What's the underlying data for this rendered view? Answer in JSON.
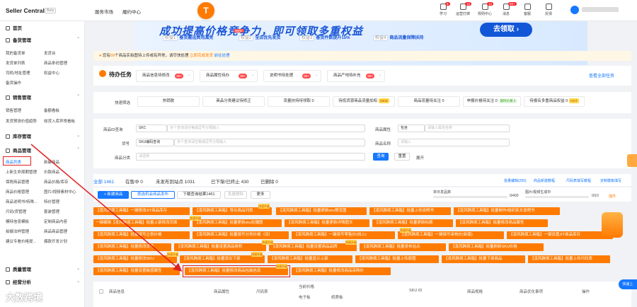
{
  "topbar": {
    "app_title": "Seller Central",
    "beta": "Beta",
    "nav": [
      "服务市场",
      "履约中心"
    ],
    "center_icon": "T",
    "icons": [
      {
        "label": "学习",
        "badge": "8"
      },
      {
        "label": "运营打牌",
        "badge": "10"
      },
      {
        "label": "规则中心",
        "badge": "12"
      },
      {
        "label": "消息",
        "badge": "99+"
      },
      {
        "label": "客服",
        "badge": ""
      },
      {
        "label": "反馈",
        "badge": ""
      }
    ]
  },
  "sidebar": {
    "home": "首页",
    "sections": [
      {
        "title": "备货管理",
        "items": [
          [
            "我的备货单",
            "发货台"
          ],
          [
            "发货单列表",
            "商品条码管理"
          ],
          [
            "司机/地址管理",
            "权益中心"
          ],
          [
            "备货操作",
            ""
          ]
        ]
      },
      {
        "title": "销售管理",
        "items": [
          [
            "销售管理",
            "备额看板"
          ],
          [
            "发货预测价值趋势",
            "收货入库异常看板"
          ]
        ]
      },
      {
        "title": "库存管理",
        "items": []
      },
      {
        "title": "商品管理",
        "items": [
          [
            "商品列表",
            "新建商品"
          ],
          [
            "上新生命周期管理",
            "价款商品"
          ],
          [
            "保税商品管理",
            "商品价格/库存"
          ],
          [
            "商品价格管理",
            "图片/视频素材中心"
          ],
          [
            "商品说明书/特殊...",
            "特价管理"
          ],
          [
            "尺码/货管理",
            "套装管理"
          ],
          [
            "模特信息模板",
            "定制商品内容"
          ],
          [
            "拍摄法样管理",
            "商品商品管理"
          ],
          [
            "建议专看价格提...",
            "爆款开发计划"
          ]
        ]
      },
      {
        "title": "质量管理",
        "items": []
      },
      {
        "title": "经营分析",
        "items": []
      }
    ]
  },
  "banner": {
    "title": "成功提高价格竞争力，即可领取多重权益",
    "items": [
      [
        "权益1",
        "备货搬运费用减免"
      ],
      [
        "权益2",
        "全店优先发货"
      ],
      [
        "权益3",
        "备货件数提升15%"
      ],
      [
        "权益4",
        "商品流量保障扶持"
      ]
    ],
    "new": "NEW",
    "button": "去领取 ›"
  },
  "notice": {
    "pre": "您有",
    "count": "89",
    "mid": "个商品实拍图待上传或有异常，请尽快处理",
    "l1": "立即完成发货",
    "l2": "前往处理"
  },
  "todo": {
    "title": "待办任务",
    "items": [
      {
        "label": "商品信息待修改",
        "count": "99+"
      },
      {
        "label": "商品属性待办",
        "count": "99+"
      },
      {
        "label": "说明书待处理",
        "count": "99+"
      },
      {
        "label": "商品产地待补充",
        "count": "99+"
      }
    ],
    "view_all": "查看全部任务"
  },
  "quick": {
    "label": "快速筛选",
    "row1": [
      "热销款",
      "商品分类建议待修正",
      "流量扶持待领取  0",
      "待低货源商品流量加权",
      "商品流量待关注  0",
      "申报价格待关注  0",
      "待报名多重商品权益  0"
    ],
    "new": "NEW",
    "tag1": "限时价格 0",
    "hot": "HOT"
  },
  "form": {
    "id_label": "商品ID查询",
    "id_type": "SKC",
    "id_ph": "多个查询请空格或逗号分隔输入",
    "attr_label": "商品属性",
    "attr_sel": "包含",
    "attr_ph": "请输入属性名称",
    "code_label": "货号",
    "code_type": "SKU编码查询",
    "code_ph": "多个查询请空格或逗号分隔输入",
    "name_label": "商品名称",
    "name_ph": "请输入",
    "cat_label": "商品分类",
    "cat_ph": "请选择",
    "search": "查询",
    "reset": "重置",
    "expand": "展开"
  },
  "tabs": {
    "items": [
      "全部 1461",
      "在售中 0",
      "未发布到站点 1031",
      "已下架/已终止 430",
      "已删除 0"
    ],
    "right": [
      "批量编辑(265)",
      "商品新建教程",
      "尺码表填写教程",
      "定制模板填写"
    ]
  },
  "actions": {
    "new": "+ 新建商品",
    "copy": "挑选机会商品发布",
    "download": "下载查询结果1461",
    "batch_del": "批量删除",
    "more": "更多",
    "progress_label": "单日发品数",
    "progress_value": "0/400",
    "progress_pct": 0,
    "dl_label": "图片/视频生成中",
    "dl_value": "0/10",
    "dl_pct": 0,
    "plugin": "插件"
  },
  "plugin_tags": [
    [
      "【凌风跨境工具箱】一键修改JIT商品库存",
      "【凌风跨境工具箱】导出商品列表",
      "【凌风跨境工具箱】批量更新sku预览图",
      "【凌风跨境工具箱】批量上传说明书",
      "【凌风跨境工具箱】批量制作/组织英文说明书"
    ],
    [
      "一键编辑【凌风跨境工具箱】批量上架修改页面",
      "【凌风跨境工具箱】批量更新sku轮播图",
      "【凌风跨境工具箱】批量更新详情图文",
      "【凌风跨境工具箱】批量更新标题",
      "【凌风跨境工具箱】批量修改商品属性"
    ],
    [
      "【凌风跨境工具箱】批量填写企划价格",
      "【凌风跨境工具箱】批量填写分类价格（旧）",
      "【凌风跨境工具箱】一键填写零售价(线上)",
      "【凌风跨境工具箱】一键填写审核价(新版)",
      "【凌风跨境工具箱】一键设置JIT商品库存"
    ],
    [
      "【凌风跨境工具箱】批量修改货号",
      "【凌风跨境工具箱】批量设置商品体积",
      "【凌风跨境工具箱】批量设置商品品牌",
      "【凌风跨境工具箱】批量发布站点",
      "【凌风跨境工具箱】批量刷新SKU价格"
    ],
    [
      "【凌风跨境工具箱】批量修改SKU",
      "【凌风跨境工具箱】批量流出下架",
      "【凌风跨境工具箱】批量显示上架",
      "【凌风跨境工具箱】批量上传原图",
      "【凌风跨境工具箱】批量下架商品",
      "【凌风跨境工具箱】批量上传尺码表"
    ],
    [
      "【凌风跨境工具箱】批量设置敏感属性",
      "【凌风跨境工具箱】批量修改商品包装信息",
      "【凌风跨境工具箱】批量修改商品采购价"
    ]
  ],
  "hot_tag": "快速升级",
  "table": {
    "headers": [
      "商品信息",
      "商品属性",
      "尺码表",
      "当前价格",
      "SKU ID",
      "商品规格",
      "商品优化事项",
      "操作"
    ],
    "sub": [
      "电子板",
      "纸质板"
    ]
  },
  "watermark": "大数跨境",
  "side_chat": "快速上"
}
